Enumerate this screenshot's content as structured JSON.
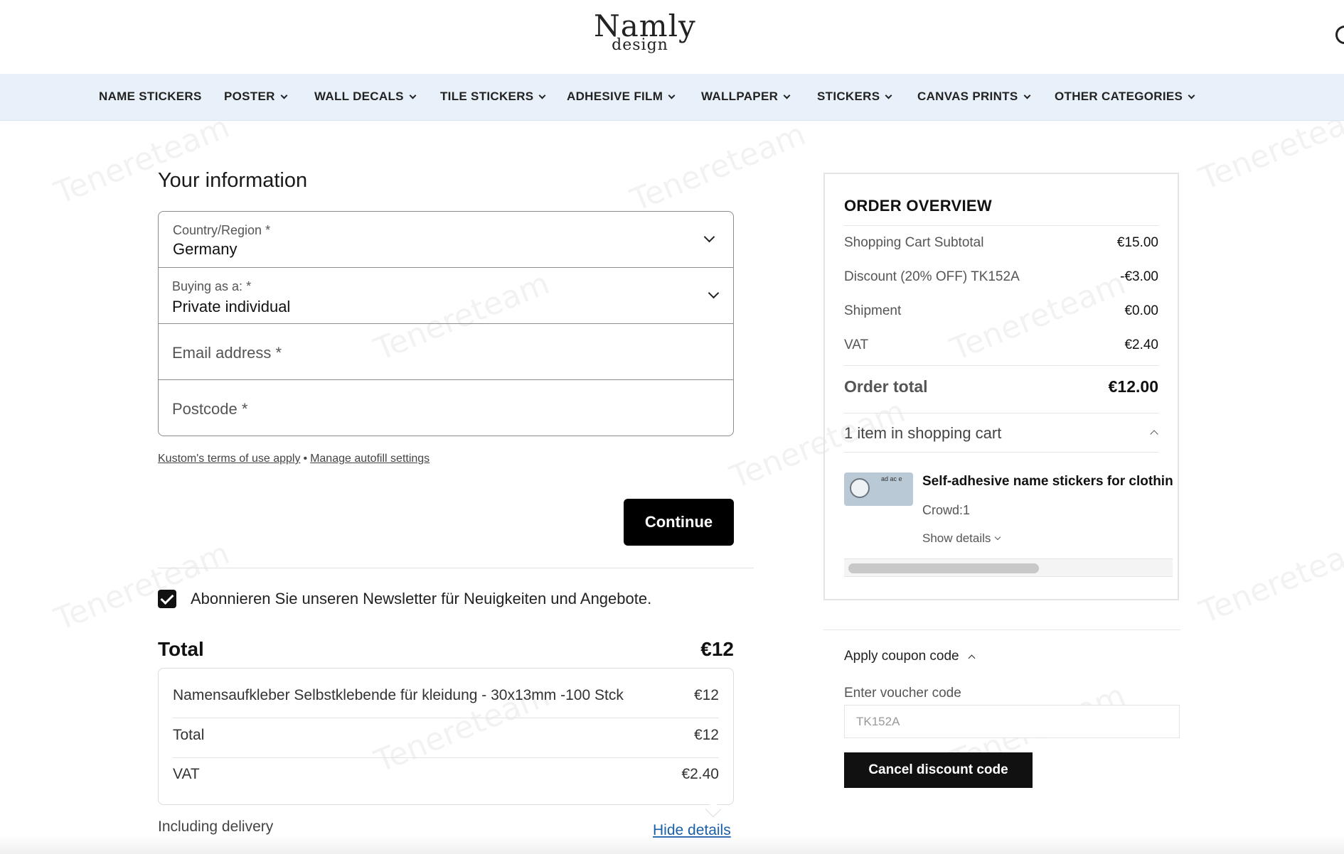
{
  "header": {
    "logo_main": "Namly",
    "logo_sub": "design"
  },
  "nav": {
    "items": [
      {
        "label": "NAME STICKERS",
        "has_dropdown": false
      },
      {
        "label": "POSTER",
        "has_dropdown": true
      },
      {
        "label": "WALL DECALS",
        "has_dropdown": true
      },
      {
        "label": "TILE STICKERS",
        "has_dropdown": true
      },
      {
        "label": "ADHESIVE FILM",
        "has_dropdown": true
      },
      {
        "label": "WALLPAPER",
        "has_dropdown": true
      },
      {
        "label": "STICKERS",
        "has_dropdown": true
      },
      {
        "label": "CANVAS PRINTS",
        "has_dropdown": true
      },
      {
        "label": "OTHER CATEGORIES",
        "has_dropdown": true
      }
    ]
  },
  "form": {
    "title": "Your information",
    "country_label": "Country/Region *",
    "country_value": "Germany",
    "buying_label": "Buying as a: *",
    "buying_value": "Private individual",
    "email_placeholder": "Email address *",
    "postcode_placeholder": "Postcode *",
    "terms_link": "Kustom's terms of use apply",
    "separator": "•",
    "autofill_link": "Manage autofill settings",
    "continue_label": "Continue",
    "newsletter_checked": true,
    "newsletter_text": "Abonnieren Sie unseren Newsletter für Neuigkeiten und Angebote."
  },
  "summary": {
    "title": "Total",
    "total_value": "€12",
    "rows": [
      {
        "label": "Namensaufkleber Selbstklebende für kleidung - 30x13mm -100 Stck",
        "value": "€12"
      },
      {
        "label": "Total",
        "value": "€12"
      },
      {
        "label": "VAT",
        "value": "€2.40"
      }
    ],
    "delivery_text": "Including delivery",
    "hide_details": "Hide details"
  },
  "overview": {
    "title": "ORDER OVERVIEW",
    "rows": [
      {
        "label": "Shopping Cart Subtotal",
        "value": "€15.00"
      },
      {
        "label": "Discount (20% OFF) TK152A",
        "value": "-€3.00"
      },
      {
        "label": "Shipment",
        "value": "€0.00"
      },
      {
        "label": "VAT",
        "value": "€2.40"
      }
    ],
    "total_label": "Order total",
    "total_value": "€12.00",
    "cart_count": "1 item in shopping cart",
    "item": {
      "thumb_text": "ad ac e",
      "title": "Self-adhesive name stickers for clothing",
      "crowd": "Crowd:1",
      "details_label": "Show details"
    },
    "scroll_fraction": 0.58
  },
  "coupon": {
    "toggle_label": "Apply coupon code",
    "voucher_label": "Enter voucher code",
    "voucher_placeholder": "TK152A",
    "cancel_label": "Cancel discount code"
  },
  "watermark": "Tenereteam",
  "colors": {
    "nav_bg": "#e8f1fa",
    "button_bg": "#000000",
    "link_blue": "#1a5fa8"
  }
}
